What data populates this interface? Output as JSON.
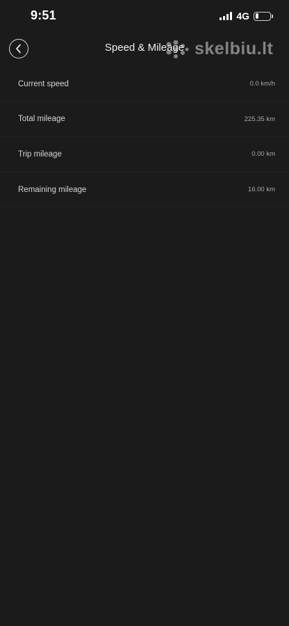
{
  "status_bar": {
    "time": "9:51",
    "network": "4G",
    "battery_level": "24",
    "battery_fraction": 0.24
  },
  "header": {
    "title": "Speed & Mileage",
    "back_icon": "chevron-left-icon"
  },
  "watermark": {
    "text": "skelbiu.lt"
  },
  "metrics": [
    {
      "label": "Current speed",
      "value": "0.0 km/h"
    },
    {
      "label": "Total mileage",
      "value": "225.35 km"
    },
    {
      "label": "Trip mileage",
      "value": "0.00 km"
    },
    {
      "label": "Remaining mileage",
      "value": "16.00 km"
    }
  ],
  "colors": {
    "background": "#1b1b1b",
    "text_primary": "#e6e6e6",
    "text_secondary": "#a8a8a8"
  }
}
